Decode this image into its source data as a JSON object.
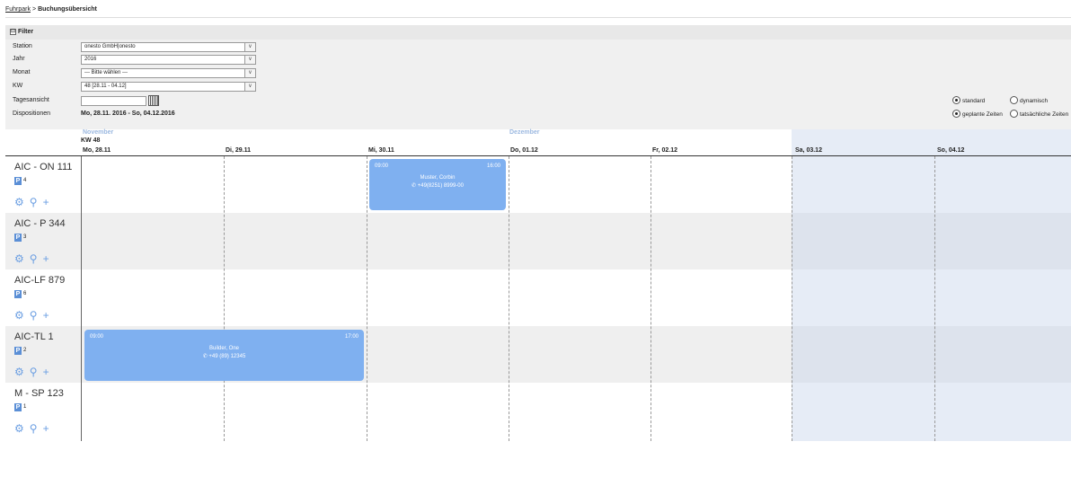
{
  "breadcrumb": {
    "link": "Fuhrpark",
    "sep": ">",
    "current": "Buchungsübersicht"
  },
  "filter": {
    "title": "Filter",
    "collapse_glyph": "⊟",
    "station_label": "Station",
    "station_value": "onesto GmbH|onesto",
    "jahr_label": "Jahr",
    "jahr_value": "2016",
    "monat_label": "Monat",
    "monat_value": "--- Bitte wählen ---",
    "kw_label": "KW",
    "kw_value": "48 [28.11 - 04.12]",
    "tages_label": "Tagesansicht",
    "dispo_label": "Dispositionen",
    "dispo_value": "Mo, 28.11. 2016 - So,  04.12.2016",
    "view_standard": "standard",
    "view_dynamisch": "dynamisch",
    "time_geplant": "geplante Zeiten",
    "time_tatsaechlich": "tatsächliche Zeiten",
    "dropdown_glyph": "∨"
  },
  "calendar": {
    "month_nov": "November",
    "month_dez": "Dezember",
    "kw": "KW 48",
    "days": [
      "Mo, 28.11",
      "Di, 29.11",
      "Mi, 30.11",
      "Do, 01.12",
      "Fr, 02.12",
      "Sa, 03.12",
      "So, 04.12"
    ]
  },
  "vehicles": [
    {
      "name": "AIC - ON 111",
      "p": "P",
      "count": "4"
    },
    {
      "name": "AIC - P 344",
      "p": "P",
      "count": "3"
    },
    {
      "name": "AIC-LF 879",
      "p": "P",
      "count": "6"
    },
    {
      "name": "AIC-TL 1",
      "p": "P",
      "count": "2"
    },
    {
      "name": "M - SP 123",
      "p": "P",
      "count": "1"
    }
  ],
  "icons": {
    "gear": "⚙",
    "search": "⚲",
    "plus": "+"
  },
  "bookings": [
    {
      "start": "09:00",
      "end": "16:00",
      "name": "Muster, Corbin",
      "phone": "✆ +49(8251) 8999-00"
    },
    {
      "start": "09:00",
      "end": "17:00",
      "name": "Builder, One",
      "phone": "✆ +49 (89) 12345"
    }
  ],
  "colors": {
    "booking": "#7fb0f0",
    "weekend": "#e6ecf6",
    "badge": "#5b8fd6",
    "month": "#9bb8e0"
  }
}
